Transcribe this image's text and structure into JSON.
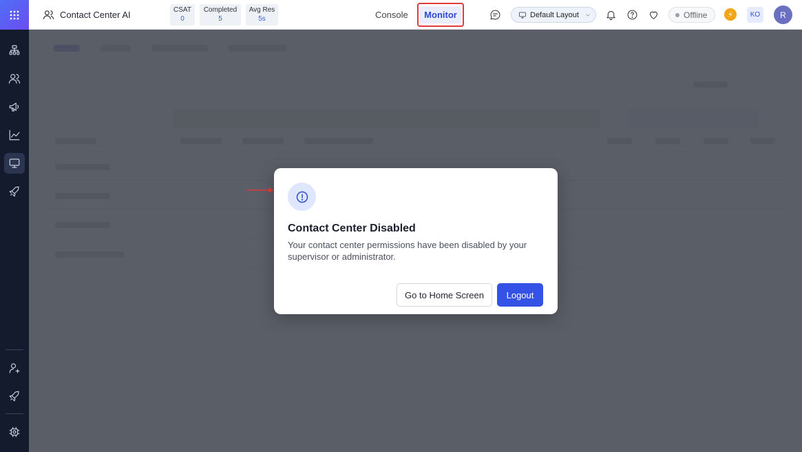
{
  "header": {
    "app_title": "Contact Center AI",
    "stats": [
      {
        "label": "CSAT",
        "value": "0"
      },
      {
        "label": "Completed",
        "value": "5"
      },
      {
        "label": "Avg Res",
        "value": "5s"
      }
    ],
    "nav": {
      "console": "Console",
      "monitor": "Monitor"
    },
    "layout_select": "Default Layout",
    "status": "Offline",
    "bolt_glyph": "⚡",
    "user_initials": "KO",
    "avatar_letter": "R"
  },
  "sidebar": {
    "top_icons": [
      "apps-grid-icon",
      "org-chart-icon",
      "users-icon",
      "megaphone-icon",
      "chart-line-icon",
      "monitor-icon",
      "rocket-icon"
    ],
    "bottom_icons": [
      "add-user-icon",
      "rocket-icon",
      "settings-chip-icon"
    ],
    "active": "monitor-icon"
  },
  "modal": {
    "title": "Contact Center Disabled",
    "message": "Your contact center permissions have been disabled by your supervisor or administrator.",
    "home_button": "Go to Home Screen",
    "logout_button": "Logout"
  },
  "colors": {
    "accent": "#3552e6",
    "sidebar_bg": "#141b2d",
    "highlight_border": "#e03a3a",
    "bolt": "#f2a516"
  }
}
